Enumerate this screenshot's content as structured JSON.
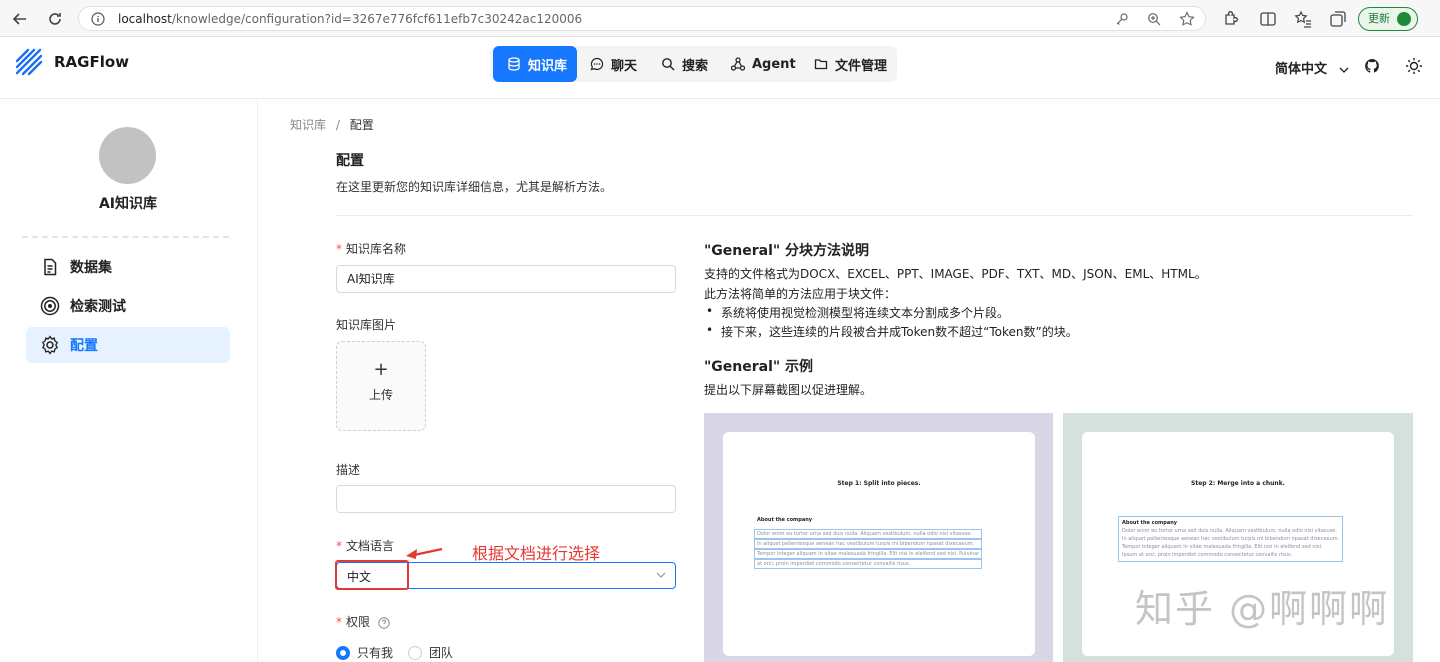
{
  "browser": {
    "url_host": "localhost",
    "url_path": "/knowledge/configuration?id=3267e776fcf611efb7c30242ac120006",
    "update_label": "更新"
  },
  "header": {
    "logo_text": "RAGFlow",
    "nav": [
      {
        "label": "知识库",
        "icon": "database-icon",
        "active": true
      },
      {
        "label": "聊天",
        "icon": "chat-icon",
        "active": false
      },
      {
        "label": "搜索",
        "icon": "search-icon",
        "active": false
      },
      {
        "label": "Agent",
        "icon": "agent-icon",
        "active": false
      },
      {
        "label": "文件管理",
        "icon": "folder-icon",
        "active": false
      }
    ],
    "language": "简体中文"
  },
  "sidebar": {
    "kb_name": "AI知识库",
    "items": [
      {
        "label": "数据集",
        "icon": "document-icon",
        "active": false
      },
      {
        "label": "检索测试",
        "icon": "target-icon",
        "active": false
      },
      {
        "label": "配置",
        "icon": "gear-icon",
        "active": true
      }
    ]
  },
  "breadcrumb": {
    "root": "知识库",
    "separator": "/",
    "current": "配置"
  },
  "page": {
    "title": "配置",
    "subtitle": "在这里更新您的知识库详细信息，尤其是解析方法。"
  },
  "form": {
    "name_label": "知识库名称",
    "name_value": "AI知识库",
    "image_label": "知识库图片",
    "upload_plus": "+",
    "upload_label": "上传",
    "desc_label": "描述",
    "desc_value": "",
    "lang_label": "文档语言",
    "lang_value": "中文",
    "annotation": "根据文档进行选择",
    "perm_label": "权限",
    "perm_options": [
      {
        "label": "只有我",
        "selected": true
      },
      {
        "label": "团队",
        "selected": false
      }
    ]
  },
  "method": {
    "title": "\"General\" 分块方法说明",
    "formats": "支持的文件格式为DOCX、EXCEL、PPT、IMAGE、PDF、TXT、MD、JSON、EML、HTML。",
    "intro": "此方法将简单的方法应用于块文件：",
    "bullets": [
      "系统将使用视觉检测模型将连续文本分割成多个片段。",
      "接下来，这些连续的片段被合并成Token数不超过“Token数”的块。"
    ],
    "example_title": "\"General\" 示例",
    "example_desc": "提出以下屏幕截图以促进理解。",
    "examples": [
      {
        "step": "Step 1: Split into pieces.",
        "heading": "About the company",
        "lines": [
          "Dolor enim eu tortor urna sed duis nulla. Aliquam vestibulum, nulla odio nisi vitasuse.",
          "In aliquet pellentesque aenean hac vestibulum turpis mi bibendum npasat dixecaeum.",
          "Tempor integer aliquam in vitae malesuada fringilla. Elit nisi in eleifend sed nisi. Pulvinar",
          "at orci, proin imperdiet commodo consectetur convallis risus."
        ],
        "bg": "#d9d7e6"
      },
      {
        "step": "Step 2: Merge into a chunk.",
        "heading": "About the company",
        "lines": [
          "Dolor enim eu tortor urna sed duis nulla. Aliquam vestibulum, nulla odio nisi vitasuse.",
          "In aliquet pellentesque aenean hac vestibulum turpis mi bibendum npasat dixecaeum.",
          "Tempor integer aliquam in vitae malesuada fringilla. Elit nisi in eleifend sed nisi.",
          "Ipsum at orci, proin imperdiet commodo consectetur convallis risus."
        ],
        "bg": "#d5e1dc"
      }
    ]
  },
  "watermark": "知乎 @啊啊啊",
  "colors": {
    "accent": "#1677ff",
    "annotation": "#e53935"
  }
}
